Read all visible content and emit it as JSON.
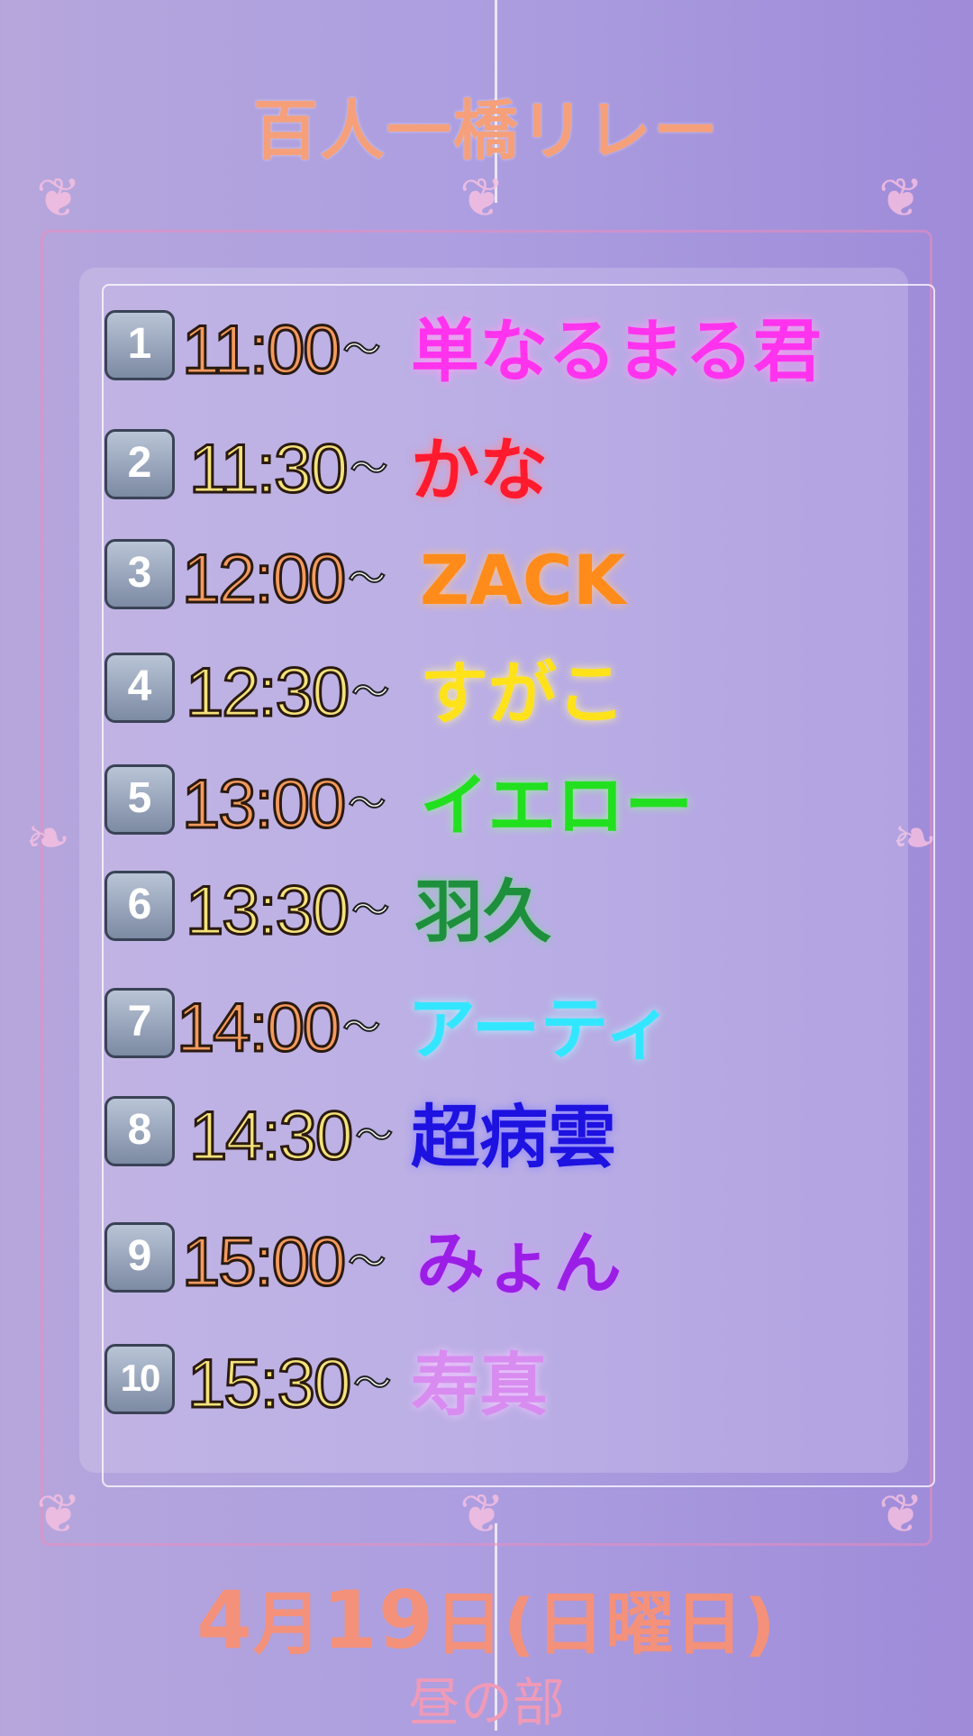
{
  "title": "百人一橋リレー",
  "schedule": [
    {
      "num": "1",
      "time": "11:00",
      "from": "〜",
      "name": "単なるまる君",
      "color": "#ff33ee",
      "time_color": "orange"
    },
    {
      "num": "2",
      "time": "11:30",
      "from": "〜",
      "name": "かな",
      "color": "#ff1a2e",
      "time_color": "yellow"
    },
    {
      "num": "3",
      "time": "12:00",
      "from": "〜",
      "name": "ZACK",
      "color": "#ff8c1a",
      "time_color": "orange"
    },
    {
      "num": "4",
      "time": "12:30",
      "from": "〜",
      "name": "すがこ",
      "color": "#ffe21a",
      "time_color": "yellow"
    },
    {
      "num": "5",
      "time": "13:00",
      "from": "〜",
      "name": "イエロー",
      "color": "#22e01f",
      "time_color": "orange"
    },
    {
      "num": "6",
      "time": "13:30",
      "from": "〜",
      "name": "羽久",
      "color": "#1e8f3c",
      "time_color": "yellow"
    },
    {
      "num": "7",
      "time": "14:00",
      "from": "〜",
      "name": "アーティ",
      "color": "#33e6ff",
      "time_color": "orange"
    },
    {
      "num": "8",
      "time": "14:30",
      "from": "〜",
      "name": "超病雲",
      "color": "#1d12e0",
      "time_color": "yellow"
    },
    {
      "num": "9",
      "time": "15:00",
      "from": "〜",
      "name": "みょん",
      "color": "#9b1ee6",
      "time_color": "orange"
    },
    {
      "num": "10",
      "time": "15:30",
      "from": "〜",
      "name": "寿真",
      "color": "#d88cf0",
      "time_color": "yellow"
    }
  ],
  "date": {
    "month": "4",
    "month_unit": "月",
    "day": "19",
    "day_unit": "日",
    "weekday": "(日曜日)"
  },
  "session": "昼の部"
}
